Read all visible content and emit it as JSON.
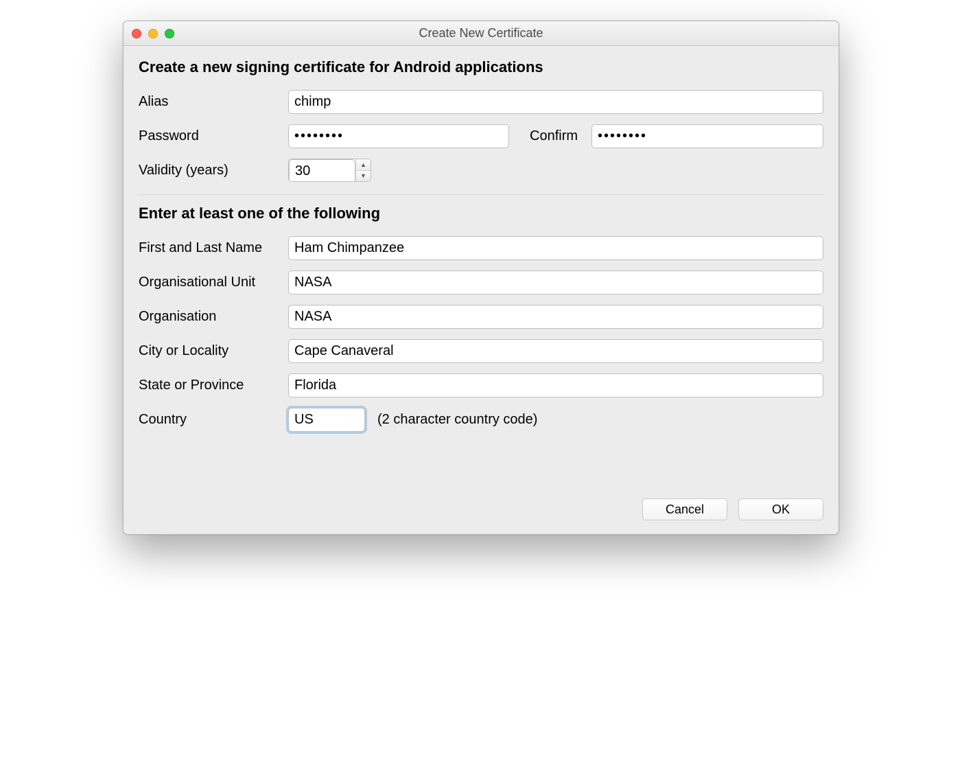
{
  "window": {
    "title": "Create New Certificate"
  },
  "section1": {
    "heading": "Create a new signing certificate for Android applications",
    "alias_label": "Alias",
    "alias_value": "chimp",
    "password_label": "Password",
    "password_value": "••••••••",
    "confirm_label": "Confirm",
    "confirm_value": "••••••••",
    "validity_label": "Validity (years)",
    "validity_value": "30"
  },
  "section2": {
    "heading": "Enter at least one of the following",
    "name_label": "First and Last Name",
    "name_value": "Ham Chimpanzee",
    "orgunit_label": "Organisational Unit",
    "orgunit_value": "NASA",
    "org_label": "Organisation",
    "org_value": "NASA",
    "city_label": "City or Locality",
    "city_value": "Cape Canaveral",
    "state_label": "State or Province",
    "state_value": "Florida",
    "country_label": "Country",
    "country_value": "US",
    "country_hint": "(2 character country code)"
  },
  "buttons": {
    "cancel": "Cancel",
    "ok": "OK"
  }
}
